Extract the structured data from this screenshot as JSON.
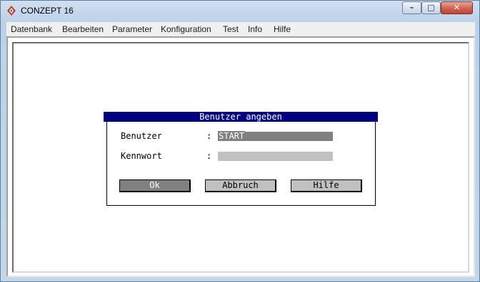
{
  "window": {
    "title": "CONZEPT 16",
    "icon": "conzept-app-icon",
    "controls": {
      "minimize": "–",
      "maximize": "□",
      "close": "✕"
    }
  },
  "menubar": {
    "items": [
      {
        "label": "Datenbank"
      },
      {
        "label": "Bearbeiten"
      },
      {
        "label": "Parameter"
      },
      {
        "label": "Konfiguration"
      },
      {
        "label": "Test"
      },
      {
        "label": "Info"
      },
      {
        "label": "Hilfe"
      }
    ]
  },
  "dialog": {
    "title": "Benutzer angeben",
    "fields": {
      "user": {
        "label": "Benutzer",
        "separator": ":",
        "value": "START"
      },
      "password": {
        "label": "Kennwort",
        "separator": ":",
        "value": ""
      }
    },
    "buttons": {
      "ok": "Ok",
      "cancel": "Abbruch",
      "help": "Hilfe"
    }
  },
  "colors": {
    "dialog_title_bg": "#000080",
    "hotkey": "#c00000",
    "ok_button_bg": "#808080",
    "button_bg": "#c0c0c0"
  }
}
